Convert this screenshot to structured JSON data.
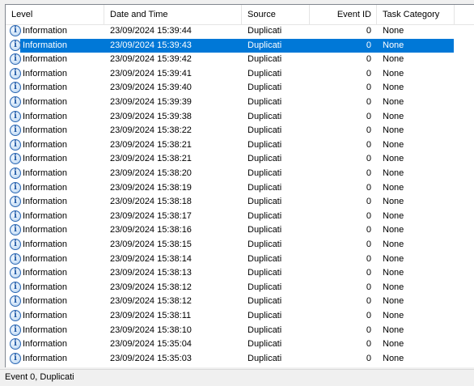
{
  "columns": {
    "level": "Level",
    "date_time": "Date and Time",
    "source": "Source",
    "event_id": "Event ID",
    "task_category": "Task Category"
  },
  "colors": {
    "selection": "#0078d7",
    "icon_ring": "#2b67b3"
  },
  "icons": {
    "level_icon": "information-icon"
  },
  "selected_index": 1,
  "rows": [
    {
      "level": "Information",
      "date_time": "23/09/2024 15:39:44",
      "source": "Duplicati",
      "event_id": "0",
      "task_category": "None"
    },
    {
      "level": "Information",
      "date_time": "23/09/2024 15:39:43",
      "source": "Duplicati",
      "event_id": "0",
      "task_category": "None"
    },
    {
      "level": "Information",
      "date_time": "23/09/2024 15:39:42",
      "source": "Duplicati",
      "event_id": "0",
      "task_category": "None"
    },
    {
      "level": "Information",
      "date_time": "23/09/2024 15:39:41",
      "source": "Duplicati",
      "event_id": "0",
      "task_category": "None"
    },
    {
      "level": "Information",
      "date_time": "23/09/2024 15:39:40",
      "source": "Duplicati",
      "event_id": "0",
      "task_category": "None"
    },
    {
      "level": "Information",
      "date_time": "23/09/2024 15:39:39",
      "source": "Duplicati",
      "event_id": "0",
      "task_category": "None"
    },
    {
      "level": "Information",
      "date_time": "23/09/2024 15:39:38",
      "source": "Duplicati",
      "event_id": "0",
      "task_category": "None"
    },
    {
      "level": "Information",
      "date_time": "23/09/2024 15:38:22",
      "source": "Duplicati",
      "event_id": "0",
      "task_category": "None"
    },
    {
      "level": "Information",
      "date_time": "23/09/2024 15:38:21",
      "source": "Duplicati",
      "event_id": "0",
      "task_category": "None"
    },
    {
      "level": "Information",
      "date_time": "23/09/2024 15:38:21",
      "source": "Duplicati",
      "event_id": "0",
      "task_category": "None"
    },
    {
      "level": "Information",
      "date_time": "23/09/2024 15:38:20",
      "source": "Duplicati",
      "event_id": "0",
      "task_category": "None"
    },
    {
      "level": "Information",
      "date_time": "23/09/2024 15:38:19",
      "source": "Duplicati",
      "event_id": "0",
      "task_category": "None"
    },
    {
      "level": "Information",
      "date_time": "23/09/2024 15:38:18",
      "source": "Duplicati",
      "event_id": "0",
      "task_category": "None"
    },
    {
      "level": "Information",
      "date_time": "23/09/2024 15:38:17",
      "source": "Duplicati",
      "event_id": "0",
      "task_category": "None"
    },
    {
      "level": "Information",
      "date_time": "23/09/2024 15:38:16",
      "source": "Duplicati",
      "event_id": "0",
      "task_category": "None"
    },
    {
      "level": "Information",
      "date_time": "23/09/2024 15:38:15",
      "source": "Duplicati",
      "event_id": "0",
      "task_category": "None"
    },
    {
      "level": "Information",
      "date_time": "23/09/2024 15:38:14",
      "source": "Duplicati",
      "event_id": "0",
      "task_category": "None"
    },
    {
      "level": "Information",
      "date_time": "23/09/2024 15:38:13",
      "source": "Duplicati",
      "event_id": "0",
      "task_category": "None"
    },
    {
      "level": "Information",
      "date_time": "23/09/2024 15:38:12",
      "source": "Duplicati",
      "event_id": "0",
      "task_category": "None"
    },
    {
      "level": "Information",
      "date_time": "23/09/2024 15:38:12",
      "source": "Duplicati",
      "event_id": "0",
      "task_category": "None"
    },
    {
      "level": "Information",
      "date_time": "23/09/2024 15:38:11",
      "source": "Duplicati",
      "event_id": "0",
      "task_category": "None"
    },
    {
      "level": "Information",
      "date_time": "23/09/2024 15:38:10",
      "source": "Duplicati",
      "event_id": "0",
      "task_category": "None"
    },
    {
      "level": "Information",
      "date_time": "23/09/2024 15:35:04",
      "source": "Duplicati",
      "event_id": "0",
      "task_category": "None"
    },
    {
      "level": "Information",
      "date_time": "23/09/2024 15:35:03",
      "source": "Duplicati",
      "event_id": "0",
      "task_category": "None"
    }
  ],
  "status": {
    "text": "Event 0, Duplicati"
  }
}
